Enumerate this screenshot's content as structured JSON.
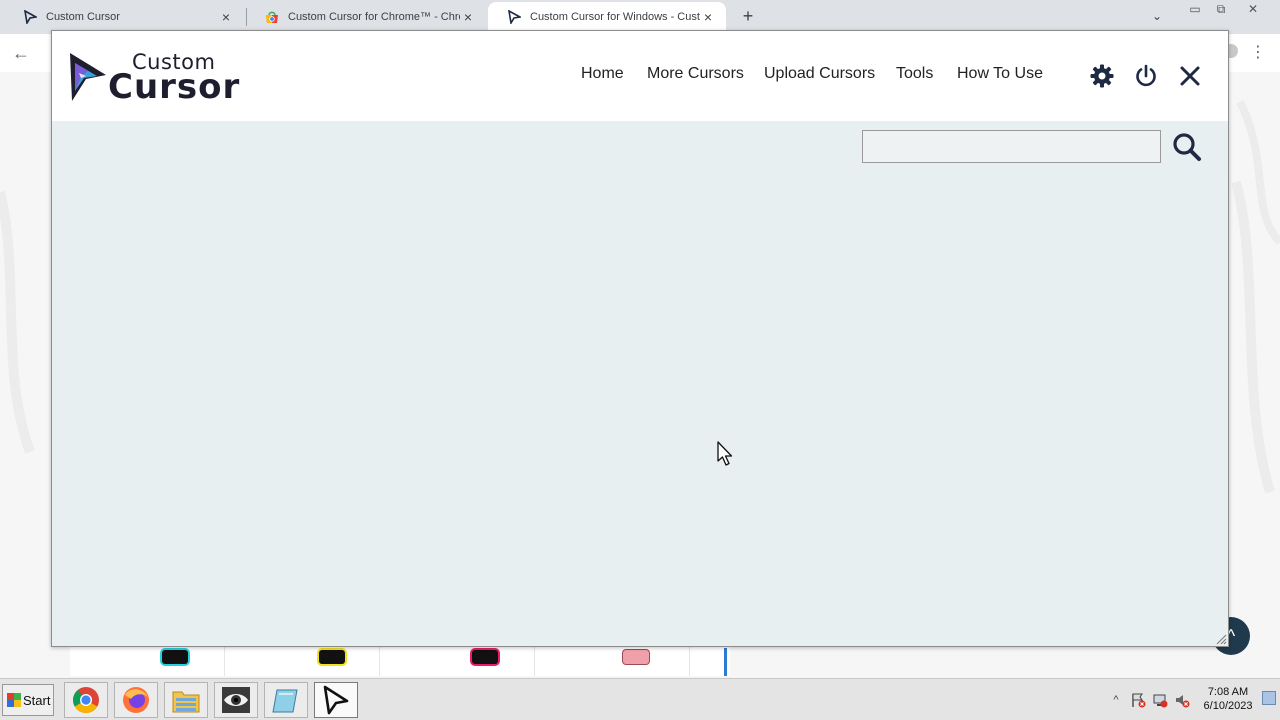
{
  "browser": {
    "tabs": [
      {
        "label": "Custom Cursor",
        "close": "×"
      },
      {
        "label": "Custom Cursor for Chrome™ - Chro",
        "close": "×"
      },
      {
        "label": "Custom Cursor for Windows - Custo",
        "close": "×"
      }
    ],
    "new_tab": "+",
    "back": "←",
    "menu": "⋮",
    "window_controls": {
      "minimize": "▭",
      "restore": "⧉",
      "close": "✕"
    },
    "tab_search": "⌄"
  },
  "popup": {
    "logo": {
      "line1": "Custom",
      "line2": "Cursor"
    },
    "nav": [
      "Home",
      "More Cursors",
      "Upload Cursors",
      "Tools",
      "How To Use"
    ],
    "icons": [
      "gear-icon",
      "power-icon",
      "close-icon"
    ],
    "search": {
      "value": "",
      "placeholder": ""
    }
  },
  "page": {
    "scroll_top": "^"
  },
  "taskbar": {
    "start_label": "Start",
    "apps": [
      "chrome-icon",
      "firefox-icon",
      "file-manager-icon",
      "eye-icon",
      "notepad-icon",
      "custom-cursor-icon"
    ],
    "tray_arrow": "^",
    "clock": {
      "time": "7:08 AM",
      "date": "6/10/2023"
    }
  },
  "colors": {
    "popup_bg": "#e8eff1",
    "header_bg": "#ffffff",
    "icon_color": "#1e2a44",
    "logo_accent_1": "#7b5cd6",
    "logo_accent_2": "#3aa0d8"
  }
}
